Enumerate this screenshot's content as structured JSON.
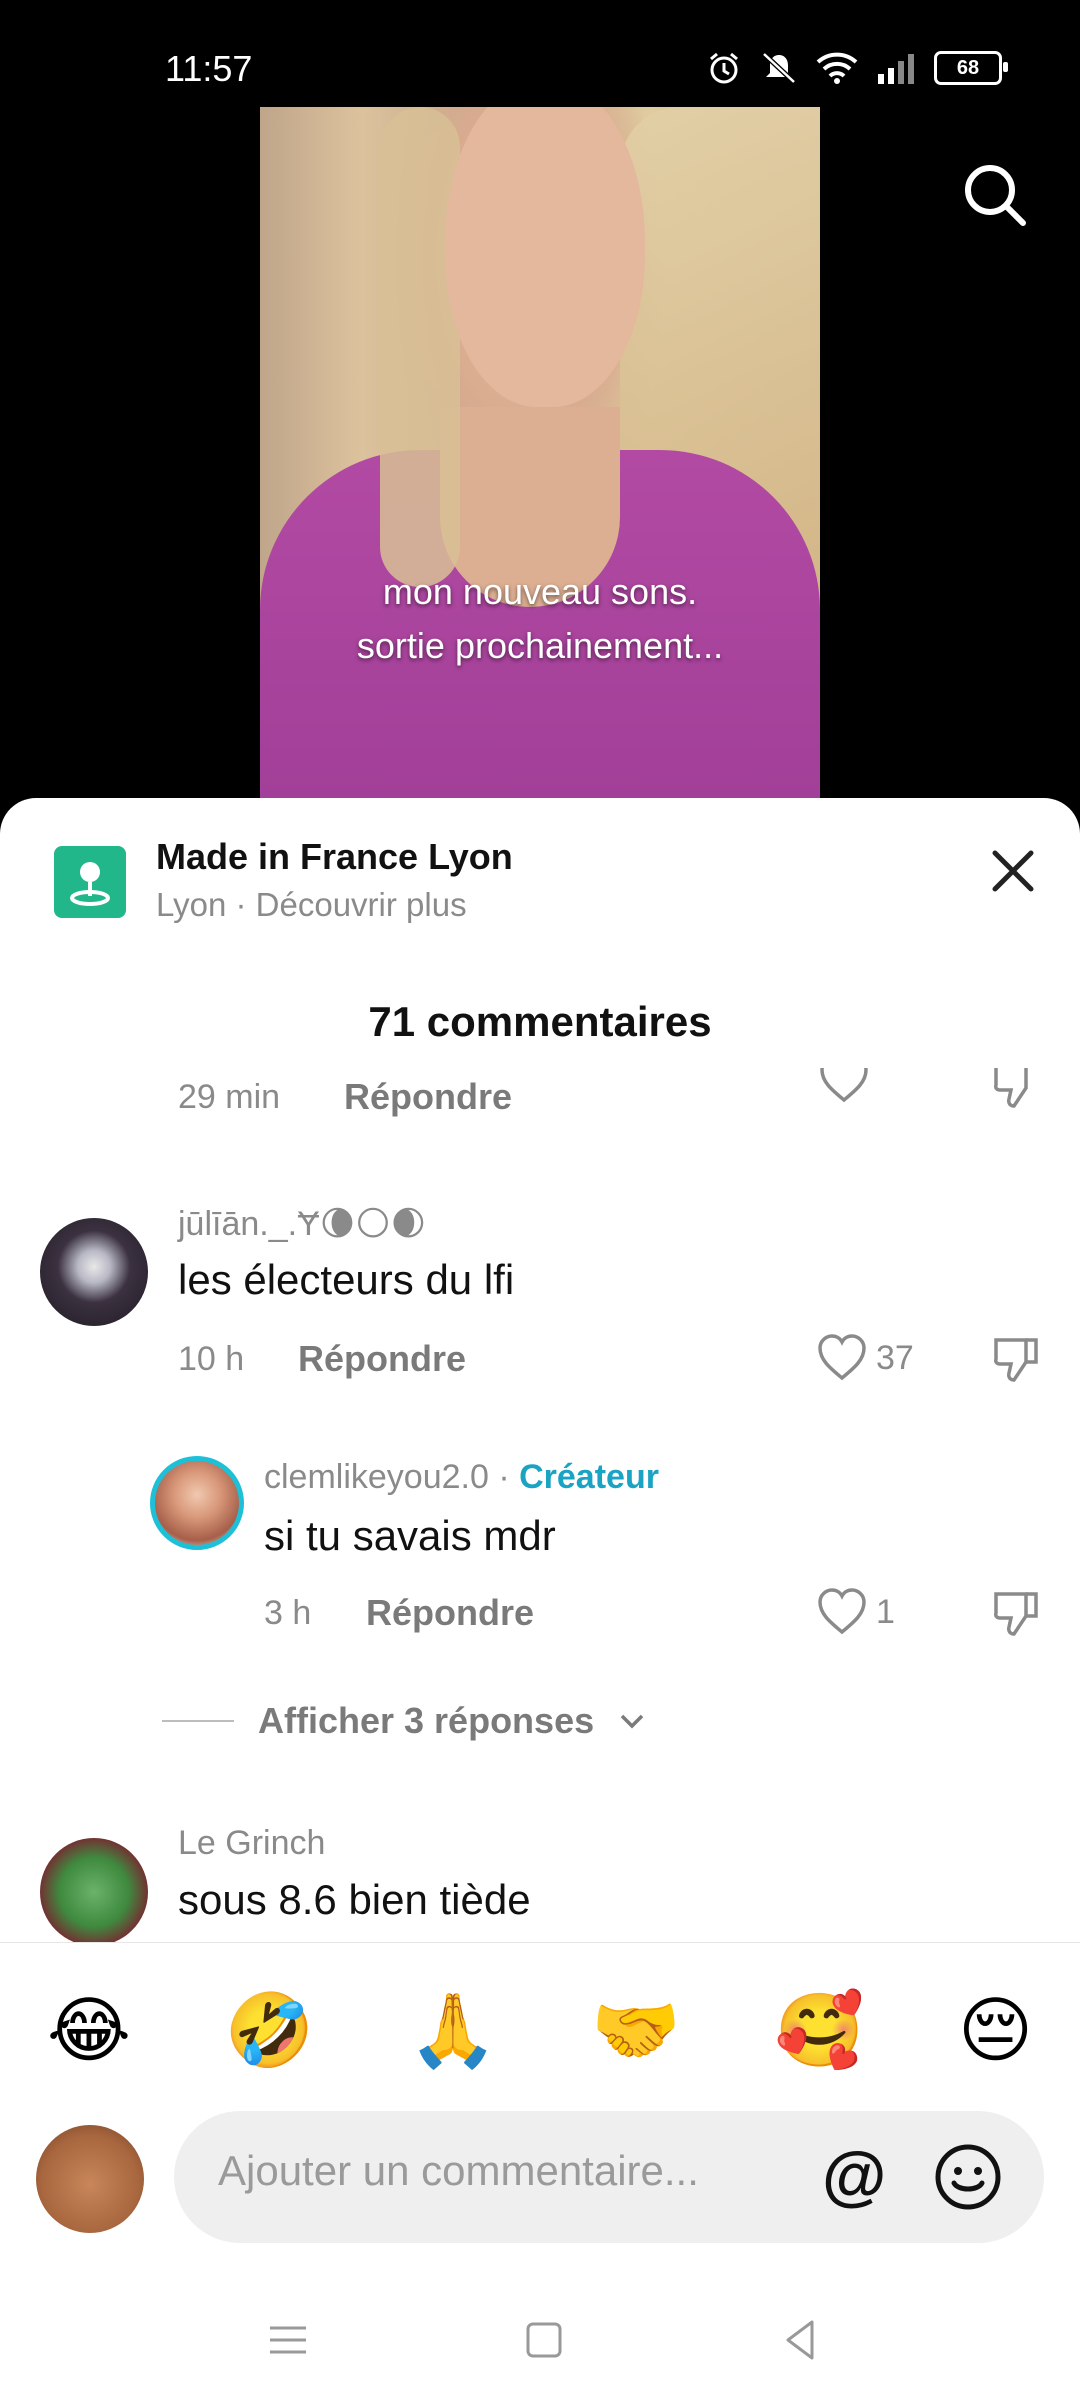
{
  "status": {
    "time": "11:57",
    "battery": "68"
  },
  "video": {
    "caption_line1": "mon nouveau sons.",
    "caption_line2": "sortie prochainement..."
  },
  "place": {
    "title": "Made in France Lyon",
    "subtitle": "Lyon · Découvrir plus"
  },
  "comments_header": "71 commentaires",
  "partial_comment": {
    "time": "29 min",
    "reply_label": "Répondre"
  },
  "comments": [
    {
      "username": "jūlīān._.Ɏ🌘🌕🌒",
      "text": "les électeurs du lfi",
      "time": "10 h",
      "reply_label": "Répondre",
      "likes": "37"
    },
    {
      "username": "clemlikeyou2.0",
      "separator": " · ",
      "creator_label": "Créateur",
      "text": "si tu savais mdr",
      "time": "3 h",
      "reply_label": "Répondre",
      "likes": "1"
    },
    {
      "username": "Le Grinch",
      "text": "sous 8.6 bien tiède"
    }
  ],
  "more_replies": "Afficher 3 réponses",
  "emojis": [
    "😂",
    "🤣",
    "🙏",
    "🤝",
    "🥰",
    "😔"
  ],
  "composer": {
    "placeholder": "Ajouter un commentaire...",
    "at": "@"
  }
}
